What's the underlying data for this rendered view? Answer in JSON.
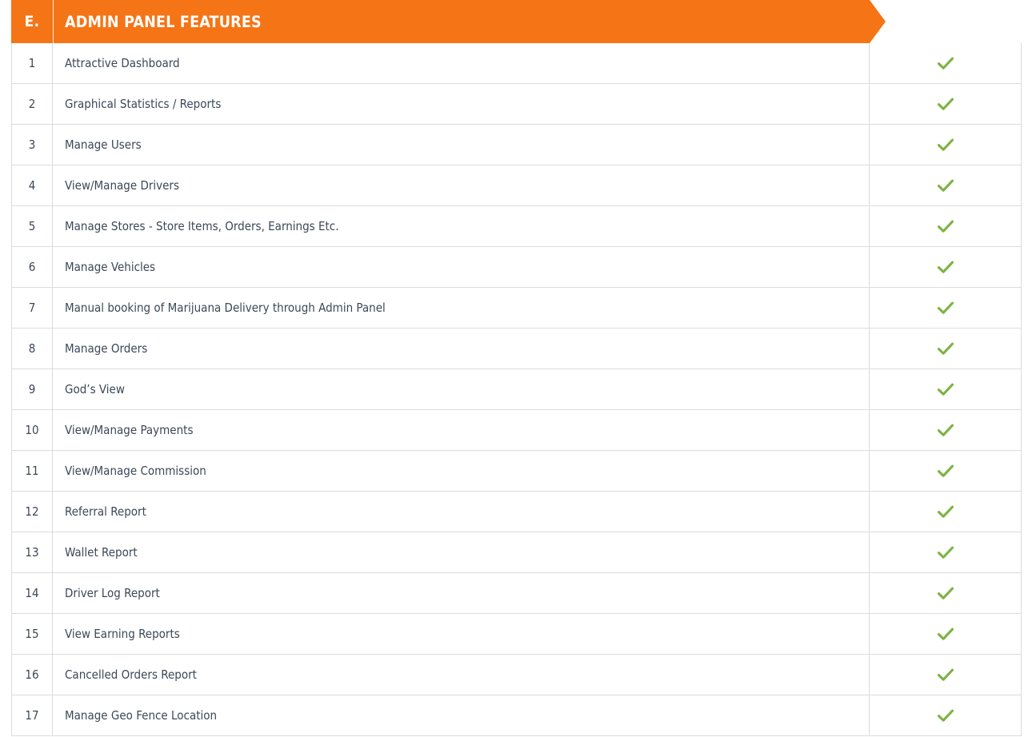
{
  "table": {
    "section_letter": "E.",
    "section_title": "ADMIN PANEL FEATURES",
    "accent_color": "#F57415",
    "fold_color": "#C75A09",
    "check_color": "#7CB342",
    "text_color": "#3c4858",
    "border_color": "#dcdcdc",
    "check_icon_name": "check-icon",
    "rows": [
      {
        "num": "1",
        "label": "Attractive Dashboard",
        "supported": true
      },
      {
        "num": "2",
        "label": "Graphical Statistics / Reports",
        "supported": true
      },
      {
        "num": "3",
        "label": "Manage Users",
        "supported": true
      },
      {
        "num": "4",
        "label": "View/Manage Drivers",
        "supported": true
      },
      {
        "num": "5",
        "label": "Manage Stores - Store Items, Orders, Earnings Etc.",
        "supported": true
      },
      {
        "num": "6",
        "label": "Manage Vehicles",
        "supported": true
      },
      {
        "num": "7",
        "label": "Manual booking of Marijuana Delivery through Admin Panel",
        "supported": true
      },
      {
        "num": "8",
        "label": "Manage Orders",
        "supported": true
      },
      {
        "num": "9",
        "label": "God’s View",
        "supported": true
      },
      {
        "num": "10",
        "label": "View/Manage Payments",
        "supported": true
      },
      {
        "num": "11",
        "label": "View/Manage Commission",
        "supported": true
      },
      {
        "num": "12",
        "label": "Referral Report",
        "supported": true
      },
      {
        "num": "13",
        "label": "Wallet Report",
        "supported": true
      },
      {
        "num": "14",
        "label": "Driver Log Report",
        "supported": true
      },
      {
        "num": "15",
        "label": "View Earning Reports",
        "supported": true
      },
      {
        "num": "16",
        "label": "Cancelled Orders Report",
        "supported": true
      },
      {
        "num": "17",
        "label": "Manage Geo Fence Location",
        "supported": true
      }
    ]
  }
}
